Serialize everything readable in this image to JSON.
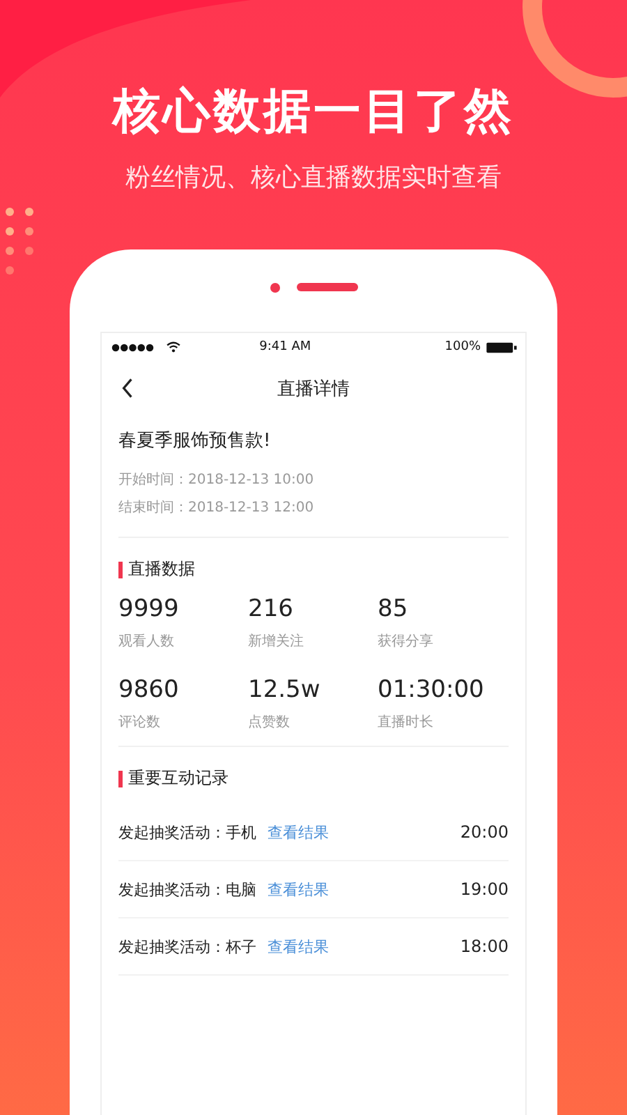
{
  "headline": "核心数据一目了然",
  "subtitle": "粉丝情况、核心直播数据实时查看",
  "status_bar": {
    "time": "9:41 AM",
    "battery": "100%"
  },
  "nav": {
    "title": "直播详情"
  },
  "event": {
    "title": "春夏季服饰预售款!",
    "start": "开始时间：2018-12-13 10:00",
    "end": "结束时间：2018-12-13 12:00"
  },
  "stats": {
    "title": "直播数据",
    "items": [
      {
        "value": "9999",
        "label": "观看人数"
      },
      {
        "value": "216",
        "label": "新增关注"
      },
      {
        "value": "85",
        "label": "获得分享"
      },
      {
        "value": "9860",
        "label": "评论数"
      },
      {
        "value": "12.5w",
        "label": "点赞数"
      },
      {
        "value": "01:30:00",
        "label": "直播时长"
      }
    ]
  },
  "records": {
    "title": "重要互动记录",
    "items": [
      {
        "text": "发起抽奖活动：手机",
        "link": "查看结果",
        "time": "20:00"
      },
      {
        "text": "发起抽奖活动：电脑",
        "link": "查看结果",
        "time": "19:00"
      },
      {
        "text": "发起抽奖活动：杯子",
        "link": "查看结果",
        "time": "18:00"
      }
    ]
  }
}
